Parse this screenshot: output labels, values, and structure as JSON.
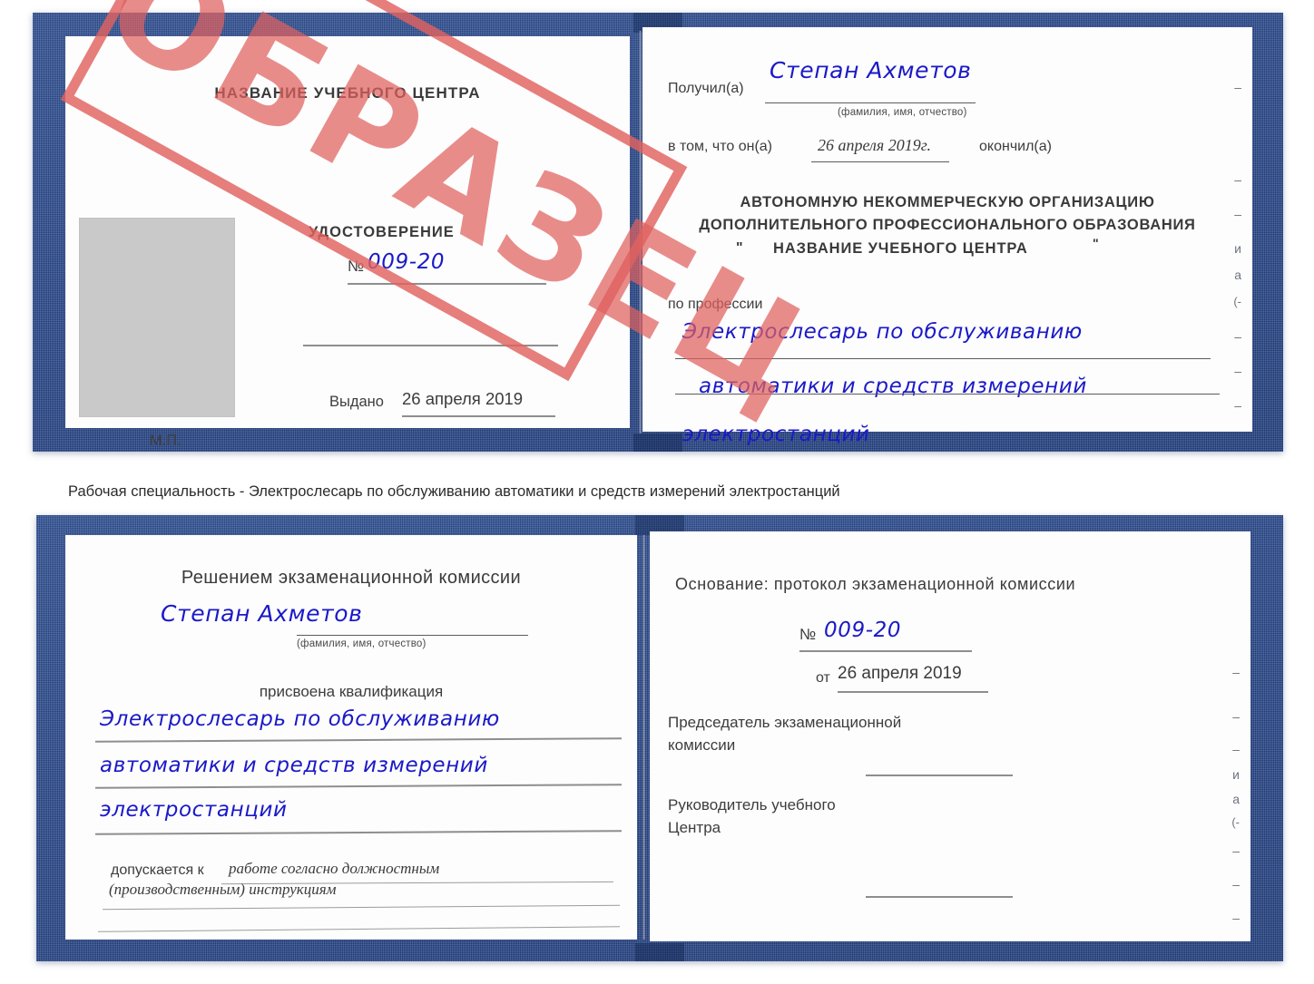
{
  "document": {
    "type": "certificate-booklet",
    "colors": {
      "cover_blue": "#27468a",
      "stamp_red": "#e0615f",
      "handwriting_blue": "#1a19c8",
      "photo_placeholder_gray": "#c9c9c9",
      "rule_gray": "#8e8e8e"
    }
  },
  "stamp": {
    "text": "ОБРАЗЕЦ"
  },
  "top_certificate": {
    "left_page": {
      "center_title": "НАЗВАНИЕ УЧЕБНОГО ЦЕНТРА",
      "doc_type": "УДОСТОВЕРЕНИЕ",
      "number_label": "№",
      "number_value": "009-20",
      "issued_label": "Выдано",
      "issued_value": "26 апреля 2019",
      "seal_label": "М.П."
    },
    "right_page": {
      "received_label": "Получил(а)",
      "received_value": "Степан Ахметов",
      "fio_hint": "(фамилия, имя, отчество)",
      "in_that_label": "в том, что он(а)",
      "completion_date": "26 апреля 2019г.",
      "finished_label": "окончил(а)",
      "org_line1": "АВТОНОМНУЮ НЕКОММЕРЧЕСКУЮ ОРГАНИЗАЦИЮ",
      "org_line2": "ДОПОЛНИТЕЛЬНОГО ПРОФЕССИОНАЛЬНОГО ОБРАЗОВАНИЯ",
      "org_quote_open": "\"",
      "org_name": "НАЗВАНИЕ УЧЕБНОГО ЦЕНТРА",
      "org_quote_close": "\"",
      "profession_label": "по профессии",
      "profession_line1": "Электрослесарь по обслуживанию",
      "profession_line2": "автоматики и средств измерений",
      "profession_line3": "электростанций",
      "bleed_marks": [
        "–",
        "–",
        "–",
        "и",
        "а",
        "(-",
        "–",
        "–",
        "–"
      ]
    }
  },
  "caption": {
    "text": "Рабочая специальность - Электрослесарь по обслуживанию автоматики и средств измерений электростанций"
  },
  "bottom_certificate": {
    "left_page": {
      "heading": "Решением экзаменационной комиссии",
      "name_value": "Степан Ахметов",
      "fio_hint": "(фамилия, имя, отчество)",
      "qualification_label": "присвоена квалификация",
      "qualification_line1": "Электрослесарь по обслуживанию",
      "qualification_line2": "автоматики и средств измерений",
      "qualification_line3": "электростанций",
      "admitted_label": "допускается к",
      "admitted_value_line1": "работе согласно должностным",
      "admitted_value_line2": "(производственным) инструкциям"
    },
    "right_page": {
      "basis_label": "Основание: протокол экзаменационной комиссии",
      "number_label": "№",
      "number_value": "009-20",
      "date_label": "от",
      "date_value": "26 апреля 2019",
      "chairman_line1": "Председатель экзаменационной",
      "chairman_line2": "комиссии",
      "head_line1": "Руководитель учебного",
      "head_line2": "Центра",
      "bleed_marks": [
        "–",
        "–",
        "–",
        "и",
        "а",
        "(-",
        "–",
        "–",
        "–"
      ]
    }
  }
}
